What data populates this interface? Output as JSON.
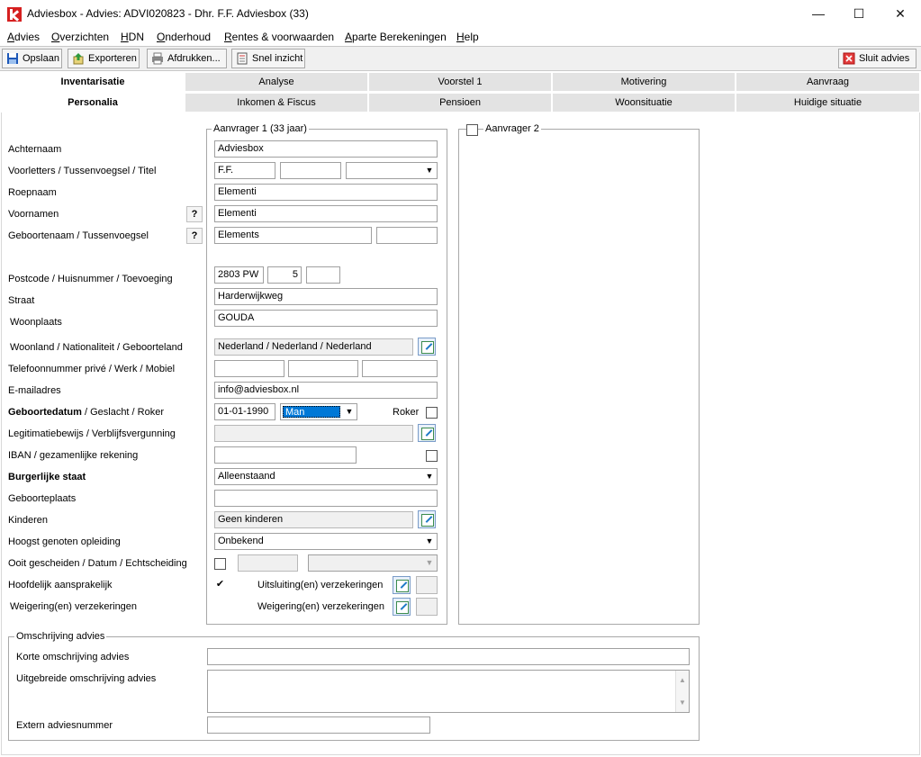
{
  "window": {
    "title": "Adviesbox - Advies: ADVI020823 - Dhr. F.F. Adviesbox (33)",
    "minimize": "—",
    "maximize": "☐",
    "close": "✕"
  },
  "menu": [
    "Advies",
    "Overzichten",
    "HDN",
    "Onderhoud",
    "Rentes & voorwaarden",
    "Aparte Berekeningen",
    "Help"
  ],
  "toolbar": {
    "save": "Opslaan",
    "export": "Exporteren",
    "print": "Afdrukken...",
    "quick": "Snel inzicht",
    "close_advice": "Sluit advies"
  },
  "tabs_main": [
    "Inventarisatie",
    "Analyse",
    "Voorstel 1",
    "Motivering",
    "Aanvraag"
  ],
  "tabs_sub": [
    "Personalia",
    "Inkomen & Fiscus",
    "Pensioen",
    "Woonsituatie",
    "Huidige situatie"
  ],
  "labels": {
    "achternaam": "Achternaam",
    "voorletters": "Voorletters / Tussenvoegsel / Titel",
    "roepnaam": "Roepnaam",
    "voornamen": "Voornamen",
    "geboortenaam": "Geboortenaam / Tussenvoegsel",
    "postcode": "Postcode / Huisnummer / Toevoeging",
    "straat": "Straat",
    "woonplaats": "Woonplaats",
    "woonland": "Woonland / Nationaliteit / Geboorteland",
    "telefoon": "Telefoonnummer privé / Werk / Mobiel",
    "email": "E-mailadres",
    "geboortedatum_bold": "Geboortedatum",
    "geboortedatum_rest": "/ Geslacht / Roker",
    "legitimatie": "Legitimatiebewijs / Verblijfsvergunning",
    "iban": "IBAN / gezamenlijke rekening",
    "burgerlijke_staat": "Burgerlijke staat",
    "geboorteplaats": "Geboorteplaats",
    "kinderen": "Kinderen",
    "opleiding": "Hoogst genoten opleiding",
    "gescheiden": "Ooit gescheiden / Datum / Echtscheiding",
    "hoofdelijk": "Hoofdelijk aansprakelijk",
    "weigering_left": "Weigering(en) verzekeringen",
    "uitsluiting": "Uitsluiting(en) verzekeringen",
    "weigering_right": "Weigering(en) verzekeringen",
    "roker": "Roker",
    "help": "?"
  },
  "aanvrager1": {
    "title": "Aanvrager 1 (33 jaar)",
    "achternaam": "Adviesbox",
    "voorletters": "F.F.",
    "tussenvoegsel": "",
    "titel": "",
    "roepnaam": "Elementi",
    "voornamen": "Elementi",
    "geboortenaam": "Elements",
    "geboortenaam_tussenvoegsel": "",
    "postcode": "2803 PW",
    "huisnummer": "5",
    "toevoeging": "",
    "straat": "Harderwijkweg",
    "woonplaats": "GOUDA",
    "woonland": "Nederland / Nederland / Nederland",
    "tel_prive": "",
    "tel_werk": "",
    "tel_mobiel": "",
    "email": "info@adviesbox.nl",
    "geboortedatum": "01-01-1990",
    "geslacht": "Man",
    "legitimatie": "",
    "iban": "",
    "burgerlijke_staat": "Alleenstaand",
    "geboorteplaats": "",
    "kinderen": "Geen kinderen",
    "opleiding": "Onbekend",
    "hoofdelijk_check": "✔"
  },
  "aanvrager2": {
    "title": "Aanvrager 2"
  },
  "omschrijving": {
    "title": "Omschrijving advies",
    "kort_label": "Korte omschrijving advies",
    "uitgebreid_label": "Uitgebreide omschrijving advies",
    "extern_label": "Extern adviesnummer",
    "kort": "",
    "uitgebreid": "",
    "extern": ""
  },
  "colors": {
    "accent": "#0078d7",
    "tab_bg": "#e3e3e3",
    "brand_red": "#d62020"
  }
}
